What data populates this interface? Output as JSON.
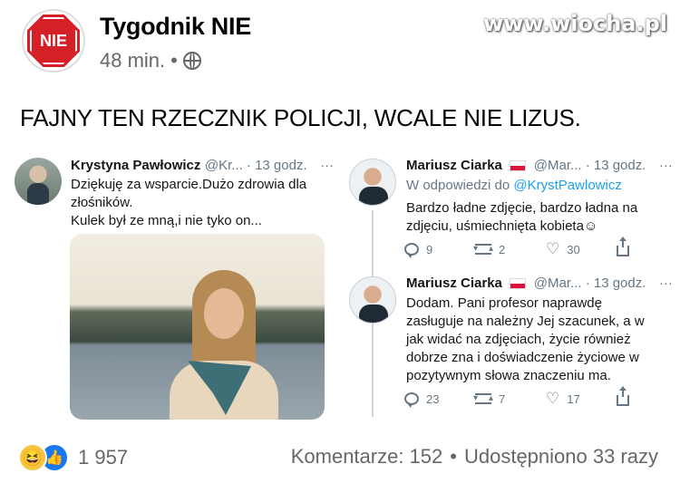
{
  "post": {
    "page_name": "Tygodnik NIE",
    "logo_text": "NIE",
    "time": "48 min.",
    "dot": "•",
    "text": "FAJNY TEN RZECZNIK POLICJI, WCALE NIE LIZUS.",
    "watermark": "www.wiocha.pl"
  },
  "left_tweet": {
    "name": "Krystyna Pawłowicz",
    "handle_time": "@Kr... · 13 godz.",
    "more": "···",
    "lines": [
      "Dziękuję za wsparcie.Dużo zdrowia dla",
      "złośników.",
      "Kulek był ze mną,i nie tyko on..."
    ]
  },
  "right_tweet_1": {
    "name": "Mariusz Ciarka",
    "handle_time": "@Mar... · 13 godz.",
    "more": "···",
    "reply_prefix": "W odpowiedzi do",
    "reply_mention": "@KrystPawlowicz",
    "lines": [
      "Bardzo ładne zdjęcie, bardzo ładna na",
      "zdjęciu, uśmiechnięta kobieta☺"
    ],
    "replies": "9",
    "retweets": "2",
    "likes": "30"
  },
  "right_tweet_2": {
    "name": "Mariusz Ciarka",
    "handle_time": "@Mar... · 13 godz.",
    "more": "···",
    "lines": [
      "Dodam. Pani profesor naprawdę",
      "zasługuje na należny Jej szacunek, a w",
      "jak widać na zdjęciach, życie również",
      "dobrze zna i doświadczenie życiowe w",
      "pozytywnym słowa znaczeniu  ma."
    ],
    "replies": "23",
    "retweets": "7",
    "likes": "17"
  },
  "footer": {
    "reaction_count": "1 957",
    "comments": "Komentarze: 152",
    "sep": "•",
    "shares": "Udostępniono 33 razy"
  }
}
